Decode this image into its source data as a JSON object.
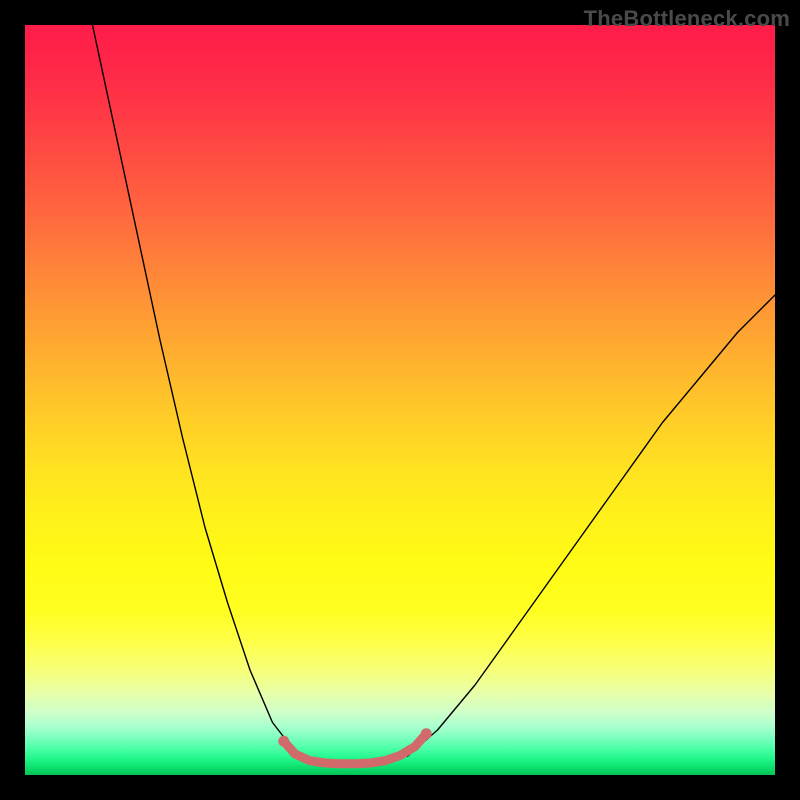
{
  "watermark": {
    "text": "TheBottleneck.com"
  },
  "chart_data": {
    "type": "line",
    "title": "",
    "xlabel": "",
    "ylabel": "",
    "xlim": [
      0,
      100
    ],
    "ylim": [
      0,
      100
    ],
    "grid": false,
    "legend": false,
    "series": [
      {
        "name": "curve-left",
        "x": [
          9,
          12,
          15,
          18,
          21,
          24,
          27,
          30,
          33,
          36.5
        ],
        "y": [
          100,
          86,
          72,
          58,
          45,
          33,
          23,
          14,
          7,
          2.5
        ],
        "color": "#000000",
        "width": 1.4
      },
      {
        "name": "curve-right",
        "x": [
          51,
          55,
          60,
          65,
          70,
          75,
          80,
          85,
          90,
          95,
          100
        ],
        "y": [
          2.5,
          6,
          12,
          19,
          26,
          33,
          40,
          47,
          53,
          59,
          64
        ],
        "color": "#000000",
        "width": 1.4
      },
      {
        "name": "valley-floor-highlight",
        "x": [
          34.5,
          36,
          38,
          40,
          42,
          44,
          46,
          48,
          50,
          52,
          53.5
        ],
        "y": [
          4.5,
          2.8,
          1.9,
          1.6,
          1.5,
          1.5,
          1.6,
          1.9,
          2.6,
          3.8,
          5.5
        ],
        "color": "#d16a6a",
        "width": 9
      }
    ],
    "background_gradient": {
      "stops": [
        {
          "t": 0.0,
          "color": "#ff1c49"
        },
        {
          "t": 0.06,
          "color": "#ff2848"
        },
        {
          "t": 0.12,
          "color": "#ff3a45"
        },
        {
          "t": 0.18,
          "color": "#ff4e42"
        },
        {
          "t": 0.24,
          "color": "#ff633f"
        },
        {
          "t": 0.3,
          "color": "#ff7a3b"
        },
        {
          "t": 0.36,
          "color": "#ff9136"
        },
        {
          "t": 0.42,
          "color": "#ffa731"
        },
        {
          "t": 0.48,
          "color": "#ffbd2c"
        },
        {
          "t": 0.54,
          "color": "#ffd226"
        },
        {
          "t": 0.6,
          "color": "#ffe420"
        },
        {
          "t": 0.66,
          "color": "#fff21a"
        },
        {
          "t": 0.72,
          "color": "#fffb15"
        },
        {
          "t": 0.78,
          "color": "#fffe20"
        },
        {
          "t": 0.82,
          "color": "#feff45"
        },
        {
          "t": 0.86,
          "color": "#f6ff78"
        },
        {
          "t": 0.89,
          "color": "#e8ffa8"
        },
        {
          "t": 0.915,
          "color": "#d0ffc8"
        },
        {
          "t": 0.935,
          "color": "#aaffce"
        },
        {
          "t": 0.95,
          "color": "#7dffbf"
        },
        {
          "t": 0.964,
          "color": "#4effa8"
        },
        {
          "t": 0.976,
          "color": "#26f98f"
        },
        {
          "t": 0.986,
          "color": "#12e977"
        },
        {
          "t": 0.994,
          "color": "#07d563"
        },
        {
          "t": 1.0,
          "color": "#02c252"
        }
      ]
    }
  }
}
